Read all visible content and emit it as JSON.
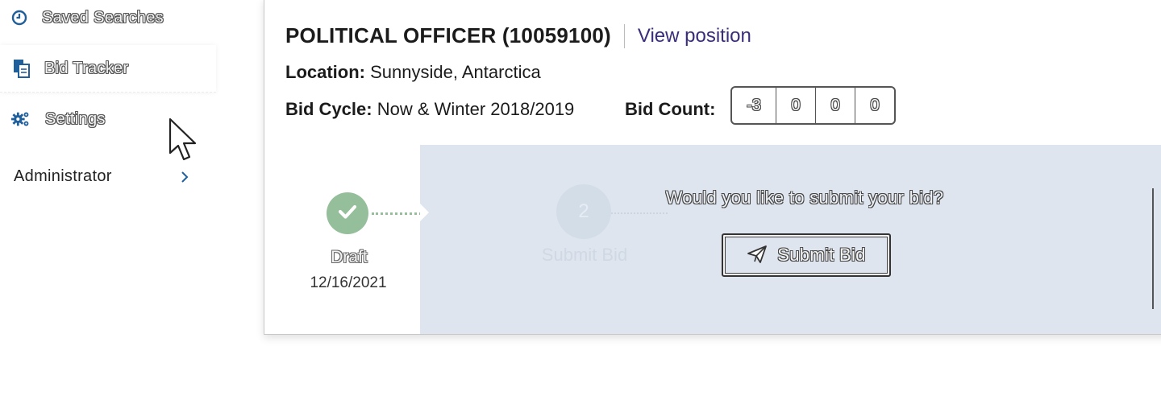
{
  "sidebar": {
    "items": [
      {
        "label": "Saved Searches",
        "icon": "clock-icon"
      },
      {
        "label": "Bid Tracker",
        "icon": "documents-icon"
      },
      {
        "label": "Settings",
        "icon": "gears-icon"
      }
    ],
    "admin": {
      "label": "Administrator",
      "icon": "chevron-right-icon"
    }
  },
  "position": {
    "title": "POLITICAL OFFICER (10059100)",
    "view_link": "View position",
    "location_label": "Location:",
    "location_value": "Sunnyside, Antarctica",
    "bid_cycle_label": "Bid Cycle:",
    "bid_cycle_value": "Now & Winter 2018/2019",
    "bid_count_label": "Bid Count:",
    "bid_counts": [
      "-3",
      "0",
      "0",
      "0"
    ]
  },
  "tracker": {
    "step1": {
      "label": "Draft",
      "date": "12/16/2021",
      "status": "complete"
    },
    "step2": {
      "number": "2",
      "label": "Submit Bid"
    },
    "prompt": "Would you like to submit your bid?",
    "submit_button": "Submit Bid"
  },
  "colors": {
    "link": "#3a2d7a",
    "complete": "#94bf9a",
    "overlay": "#dfe5ef",
    "icon_blue": "#1f5f9c"
  }
}
